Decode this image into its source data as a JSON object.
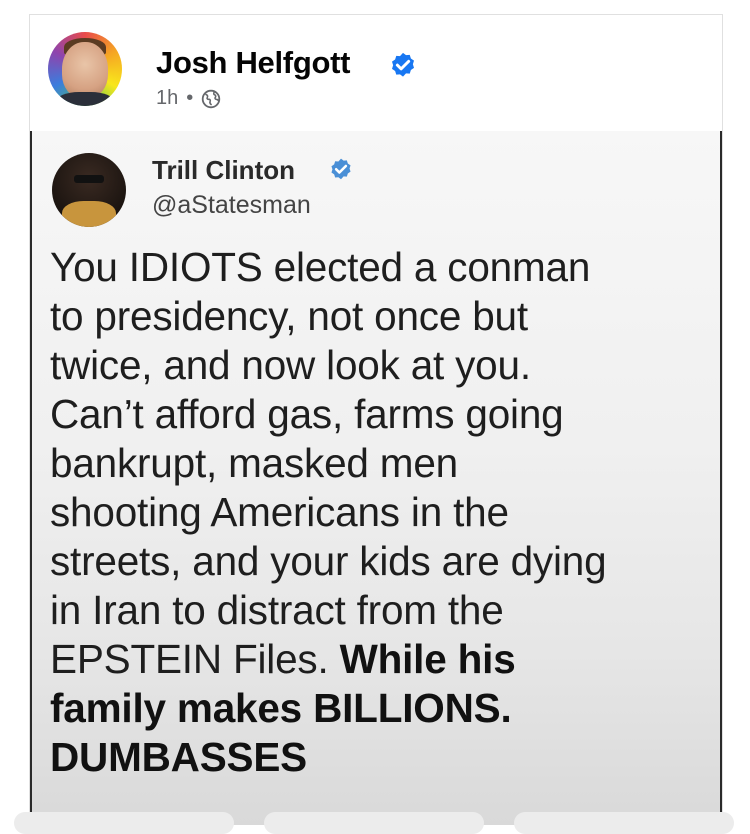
{
  "post": {
    "author_name": "Josh Helfgott",
    "time": "1h",
    "separator": "•",
    "audience_icon": "globe-icon",
    "verified_icon": "verified-badge-icon"
  },
  "tweet": {
    "display_name": "Trill Clinton",
    "handle": "@aStatesman",
    "verified_icon": "verified-badge-icon",
    "lines": [
      "You IDIOTS elected a conman",
      "to presidency, not once but",
      "twice, and now look at you.",
      "Can’t afford gas, farms going",
      "bankrupt, masked men",
      "shooting Americans in the",
      "streets, and your kids are dying",
      "in Iran to distract from the"
    ],
    "line9_normal": "EPSTEIN Files. ",
    "line9_bold": "While his",
    "line10_bold": "family makes BILLIONS.",
    "line11_bold": "DUMBASSES"
  },
  "colors": {
    "verified_blue": "#1877f2",
    "tweet_verified_blue": "#4a8fd6"
  }
}
